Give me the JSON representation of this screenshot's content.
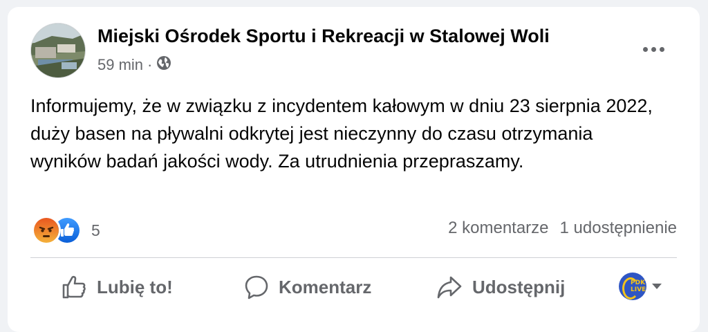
{
  "post": {
    "author": "Miejski Ośrodek Sportu i Rekreacji w Stalowej Woli",
    "time": "59 min",
    "separator": "·",
    "audience_icon": "globe-icon",
    "text": "Informujemy, że w związku z incydentem kałowym w dniu 23 sierpnia 2022, duży basen na pływalni odkrytej jest nieczynny do czasu otrzymania wyników badań jakości wody. Za utrudnienia przepraszamy."
  },
  "reactions": {
    "icons": [
      "angry-reaction-icon",
      "like-reaction-icon"
    ],
    "count": "5"
  },
  "stats": {
    "comments": "2 komentarze",
    "shares": "1 udostępnienie"
  },
  "actions": {
    "like": "Lubię to!",
    "comment": "Komentarz",
    "share": "Udostępnij"
  },
  "acting_as": {
    "avatar_text_line1": "PDK",
    "avatar_text_line2": "LIVE"
  },
  "colors": {
    "background": "#f0f2f5",
    "card": "#ffffff",
    "secondary_text": "#65676b",
    "like_blue": "#1877f2",
    "angry_orange": "#e9710f"
  }
}
